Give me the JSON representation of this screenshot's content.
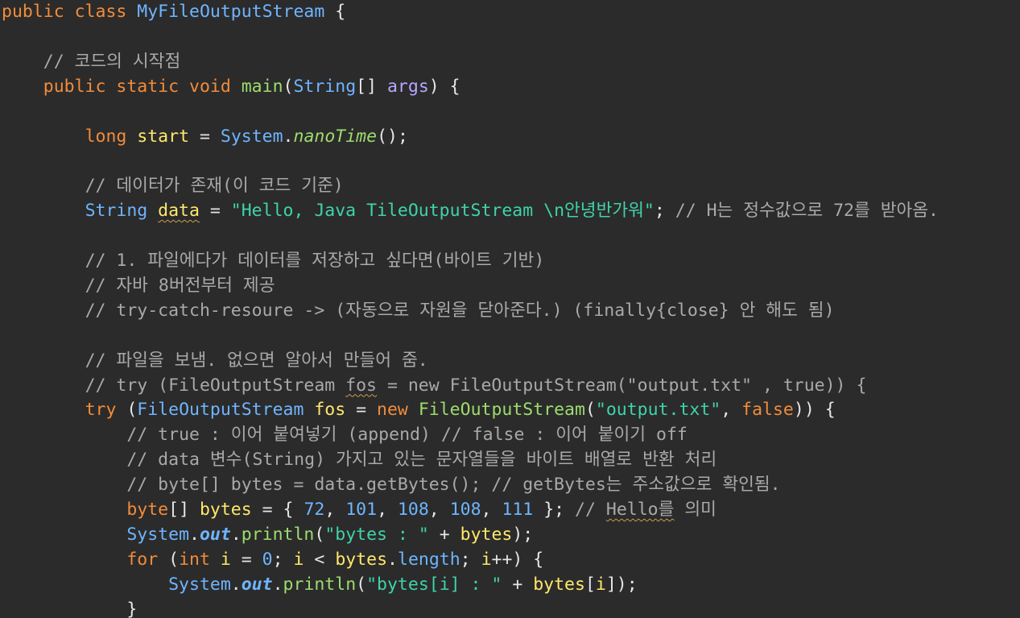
{
  "editor": {
    "language": "Java",
    "theme_colors": {
      "background": "#2b2b2b",
      "keyword": "#f28c3b",
      "type": "#6fb5ff",
      "class_name": "#9ddc6e",
      "string": "#3fd3a9",
      "comment": "#a9a9a9",
      "number": "#6fb5ff",
      "variable": "#ffe86b",
      "plain": "#e6e6e6"
    },
    "lines": [
      {
        "indent": "",
        "tokens": [
          {
            "t": "public class ",
            "c": "#f28c3b"
          },
          {
            "t": "MyFileOutputStream",
            "c": "#6fb5ff"
          },
          {
            "t": " {",
            "c": "#e6e6e6"
          }
        ]
      },
      {
        "indent": "",
        "tokens": []
      },
      {
        "indent": "    ",
        "tokens": [
          {
            "t": "// 코드의 시작점",
            "c": "#a9a9a9"
          }
        ]
      },
      {
        "indent": "    ",
        "tokens": [
          {
            "t": "public static void ",
            "c": "#f28c3b"
          },
          {
            "t": "main",
            "c": "#9ddc6e"
          },
          {
            "t": "(",
            "c": "#e6e6e6"
          },
          {
            "t": "String",
            "c": "#6fb5ff"
          },
          {
            "t": "[] ",
            "c": "#e6e6e6"
          },
          {
            "t": "args",
            "c": "#b8a6ff"
          },
          {
            "t": ") {",
            "c": "#e6e6e6"
          }
        ]
      },
      {
        "indent": "",
        "tokens": []
      },
      {
        "indent": "        ",
        "tokens": [
          {
            "t": "long ",
            "c": "#f28c3b"
          },
          {
            "t": "start",
            "c": "#ffe86b"
          },
          {
            "t": " = ",
            "c": "#e6e6e6"
          },
          {
            "t": "System",
            "c": "#6fb5ff"
          },
          {
            "t": ".",
            "c": "#e6e6e6"
          },
          {
            "t": "nanoTime",
            "c": "#9ddc6e",
            "italic": true
          },
          {
            "t": "();",
            "c": "#e6e6e6"
          }
        ]
      },
      {
        "indent": "",
        "tokens": []
      },
      {
        "indent": "        ",
        "tokens": [
          {
            "t": "// 데이터가 존재(이 코드 기준)",
            "c": "#a9a9a9"
          }
        ]
      },
      {
        "indent": "        ",
        "tokens": [
          {
            "t": "String ",
            "c": "#6fb5ff"
          },
          {
            "t": "data",
            "c": "#ffe86b",
            "squiggle": true
          },
          {
            "t": " = ",
            "c": "#e6e6e6"
          },
          {
            "t": "\"Hello, Java TileOutputStream \\n안녕반가워\"",
            "c": "#3fd3a9"
          },
          {
            "t": "; ",
            "c": "#e6e6e6"
          },
          {
            "t": "// H는 정수값으로 72를 받아옴.",
            "c": "#a9a9a9"
          }
        ]
      },
      {
        "indent": "",
        "tokens": []
      },
      {
        "indent": "        ",
        "tokens": [
          {
            "t": "// 1. 파일에다가 데이터를 저장하고 싶다면(바이트 기반)",
            "c": "#a9a9a9"
          }
        ]
      },
      {
        "indent": "        ",
        "tokens": [
          {
            "t": "// 자바 8버전부터 제공",
            "c": "#a9a9a9"
          }
        ]
      },
      {
        "indent": "        ",
        "tokens": [
          {
            "t": "// try-catch-resoure -> (자동으로 자원을 닫아준다.) (finally{close} 안 해도 됨)",
            "c": "#a9a9a9"
          }
        ]
      },
      {
        "indent": "",
        "tokens": []
      },
      {
        "indent": "        ",
        "tokens": [
          {
            "t": "// 파일을 보냄. 없으면 알아서 만들어 줌.",
            "c": "#a9a9a9"
          }
        ]
      },
      {
        "indent": "        ",
        "tokens": [
          {
            "t": "// try (FileOutputStream ",
            "c": "#a9a9a9"
          },
          {
            "t": "fos",
            "c": "#a9a9a9",
            "squiggle": true
          },
          {
            "t": " = new FileOutputStream(\"output.txt\" , true)) {",
            "c": "#a9a9a9"
          }
        ]
      },
      {
        "indent": "        ",
        "tokens": [
          {
            "t": "try",
            "c": "#f28c3b"
          },
          {
            "t": " (",
            "c": "#e6e6e6"
          },
          {
            "t": "FileOutputStream",
            "c": "#6fb5ff"
          },
          {
            "t": " ",
            "c": "#e6e6e6"
          },
          {
            "t": "fos",
            "c": "#ffe86b"
          },
          {
            "t": " = ",
            "c": "#e6e6e6"
          },
          {
            "t": "new",
            "c": "#f28c3b"
          },
          {
            "t": " ",
            "c": "#e6e6e6"
          },
          {
            "t": "FileOutputStream",
            "c": "#9ddc6e"
          },
          {
            "t": "(",
            "c": "#e6e6e6"
          },
          {
            "t": "\"output.txt\"",
            "c": "#3fd3a9"
          },
          {
            "t": ", ",
            "c": "#e6e6e6"
          },
          {
            "t": "false",
            "c": "#f28c3b"
          },
          {
            "t": ")) {",
            "c": "#e6e6e6"
          }
        ]
      },
      {
        "indent": "            ",
        "tokens": [
          {
            "t": "// true : 이어 붙여넣기 (append) // false : 이어 붙이기 off",
            "c": "#a9a9a9"
          }
        ]
      },
      {
        "indent": "            ",
        "tokens": [
          {
            "t": "// data 변수(String) 가지고 있는 문자열들을 바이트 배열로 반환 처리",
            "c": "#a9a9a9"
          }
        ]
      },
      {
        "indent": "            ",
        "tokens": [
          {
            "t": "// byte[] bytes = data.getBytes(); // getBytes는 주소값으로 확인됨.",
            "c": "#a9a9a9"
          }
        ]
      },
      {
        "indent": "            ",
        "tokens": [
          {
            "t": "byte",
            "c": "#f28c3b"
          },
          {
            "t": "[] ",
            "c": "#e6e6e6"
          },
          {
            "t": "bytes",
            "c": "#ffe86b"
          },
          {
            "t": " = { ",
            "c": "#e6e6e6"
          },
          {
            "t": "72",
            "c": "#6fb5ff"
          },
          {
            "t": ", ",
            "c": "#e6e6e6"
          },
          {
            "t": "101",
            "c": "#6fb5ff"
          },
          {
            "t": ", ",
            "c": "#e6e6e6"
          },
          {
            "t": "108",
            "c": "#6fb5ff"
          },
          {
            "t": ", ",
            "c": "#e6e6e6"
          },
          {
            "t": "108",
            "c": "#6fb5ff"
          },
          {
            "t": ", ",
            "c": "#e6e6e6"
          },
          {
            "t": "111",
            "c": "#6fb5ff"
          },
          {
            "t": " }; ",
            "c": "#e6e6e6"
          },
          {
            "t": "// ",
            "c": "#a9a9a9"
          },
          {
            "t": "Hello를",
            "c": "#a9a9a9",
            "squiggle": true
          },
          {
            "t": " 의미",
            "c": "#a9a9a9"
          }
        ]
      },
      {
        "indent": "            ",
        "tokens": [
          {
            "t": "System",
            "c": "#6fb5ff"
          },
          {
            "t": ".",
            "c": "#e6e6e6"
          },
          {
            "t": "out",
            "c": "#6fb5ff",
            "italic": true,
            "bold": true
          },
          {
            "t": ".",
            "c": "#e6e6e6"
          },
          {
            "t": "println",
            "c": "#9ddc6e"
          },
          {
            "t": "(",
            "c": "#e6e6e6"
          },
          {
            "t": "\"bytes : \"",
            "c": "#3fd3a9"
          },
          {
            "t": " + ",
            "c": "#e6e6e6"
          },
          {
            "t": "bytes",
            "c": "#ffe86b"
          },
          {
            "t": ");",
            "c": "#e6e6e6"
          }
        ]
      },
      {
        "indent": "            ",
        "tokens": [
          {
            "t": "for",
            "c": "#f28c3b"
          },
          {
            "t": " (",
            "c": "#e6e6e6"
          },
          {
            "t": "int",
            "c": "#f28c3b"
          },
          {
            "t": " ",
            "c": "#e6e6e6"
          },
          {
            "t": "i",
            "c": "#ffe86b"
          },
          {
            "t": " = ",
            "c": "#e6e6e6"
          },
          {
            "t": "0",
            "c": "#6fb5ff"
          },
          {
            "t": "; ",
            "c": "#e6e6e6"
          },
          {
            "t": "i",
            "c": "#ffe86b"
          },
          {
            "t": " < ",
            "c": "#e6e6e6"
          },
          {
            "t": "bytes",
            "c": "#ffe86b"
          },
          {
            "t": ".",
            "c": "#e6e6e6"
          },
          {
            "t": "length",
            "c": "#6fb5ff"
          },
          {
            "t": "; ",
            "c": "#e6e6e6"
          },
          {
            "t": "i",
            "c": "#ffe86b"
          },
          {
            "t": "++) {",
            "c": "#e6e6e6"
          }
        ]
      },
      {
        "indent": "                ",
        "tokens": [
          {
            "t": "System",
            "c": "#6fb5ff"
          },
          {
            "t": ".",
            "c": "#e6e6e6"
          },
          {
            "t": "out",
            "c": "#6fb5ff",
            "italic": true,
            "bold": true
          },
          {
            "t": ".",
            "c": "#e6e6e6"
          },
          {
            "t": "println",
            "c": "#9ddc6e"
          },
          {
            "t": "(",
            "c": "#e6e6e6"
          },
          {
            "t": "\"bytes[i] : \"",
            "c": "#3fd3a9"
          },
          {
            "t": " + ",
            "c": "#e6e6e6"
          },
          {
            "t": "bytes",
            "c": "#ffe86b"
          },
          {
            "t": "[",
            "c": "#e6e6e6"
          },
          {
            "t": "i",
            "c": "#ffe86b"
          },
          {
            "t": "]);",
            "c": "#e6e6e6"
          }
        ]
      },
      {
        "indent": "            ",
        "tokens": [
          {
            "t": "}",
            "c": "#e6e6e6"
          }
        ]
      }
    ]
  }
}
